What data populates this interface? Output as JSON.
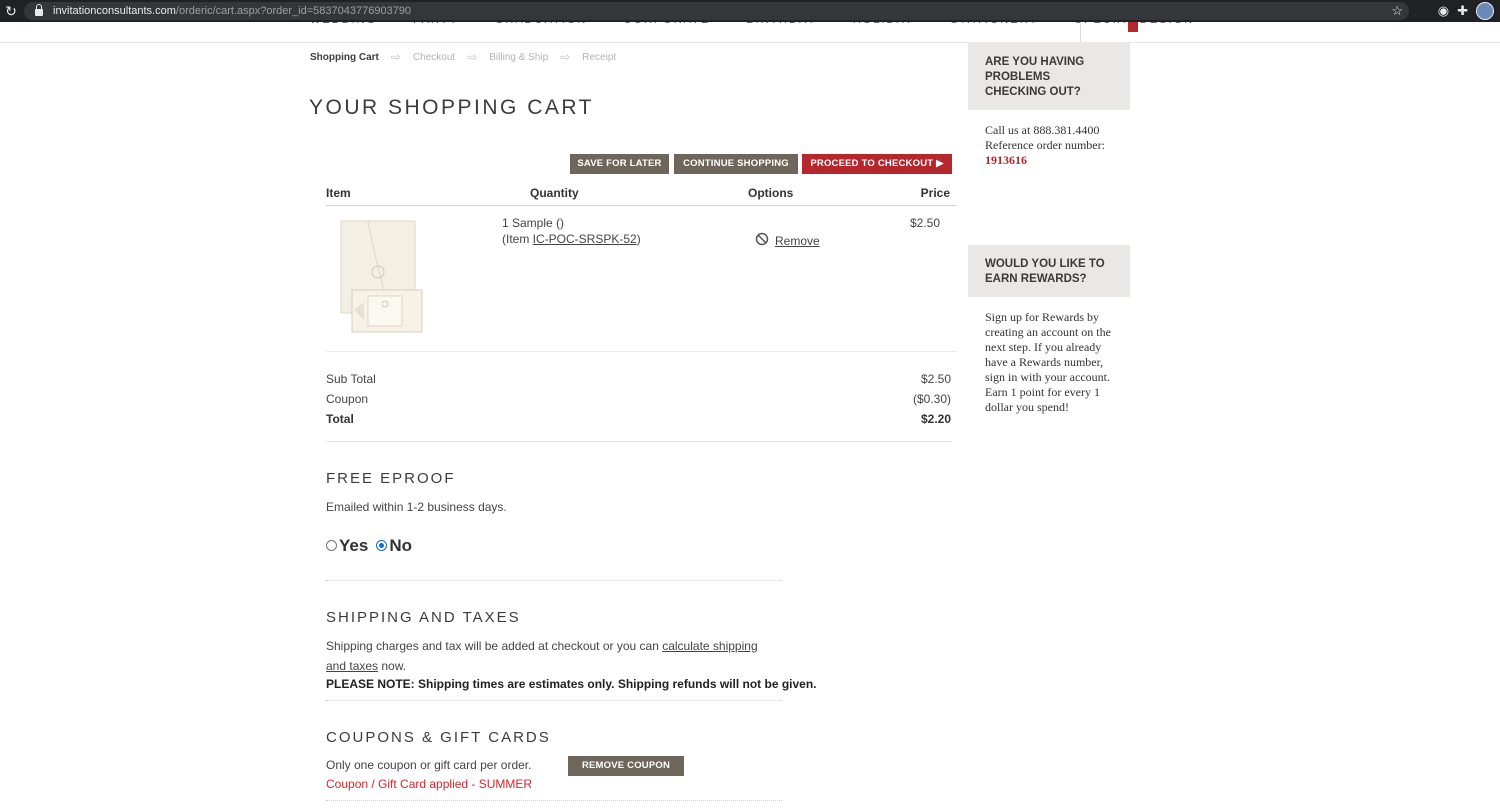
{
  "browser": {
    "url_host": "invitationconsultants.com",
    "url_path": "/orderic/cart.aspx?order_id=5837043776903790"
  },
  "nav": {
    "items": [
      "WEDDING",
      "PARTY",
      "GRADUATION",
      "CORPORATE",
      "BIRTHDAY",
      "HOLIDAY",
      "STATIONERY",
      "SPECIAL DESIGN"
    ]
  },
  "steps": [
    "Shopping Cart",
    "Checkout",
    "Billing & Ship",
    "Receipt"
  ],
  "page_title": "YOUR SHOPPING CART",
  "actions": {
    "save_later": "SAVE FOR LATER",
    "continue": "CONTINUE SHOPPING",
    "checkout": "PROCEED TO CHECKOUT"
  },
  "table": {
    "headers": {
      "item": "Item",
      "quantity": "Quantity",
      "options": "Options",
      "price": "Price"
    },
    "row": {
      "qty_line": "1 Sample ()",
      "item_prefix": "(Item ",
      "item_code": "IC-POC-SRSPK-52",
      "item_suffix": ")",
      "remove": "Remove",
      "price": "$2.50"
    }
  },
  "totals": {
    "subtotal_label": "Sub Total",
    "subtotal": "$2.50",
    "coupon_label": "Coupon",
    "coupon": "($0.30)",
    "total_label": "Total",
    "total": "$2.20"
  },
  "eproof": {
    "title": "FREE EPROOF",
    "desc": "Emailed within 1-2 business days.",
    "yes": "Yes",
    "no": "No",
    "selected": "No"
  },
  "shipping": {
    "title": "SHIPPING AND TAXES",
    "text_before": "Shipping charges and tax will be added at checkout or you can ",
    "link": "calculate shipping and taxes",
    "text_after": " now.",
    "note": "PLEASE NOTE: Shipping times are estimates only. Shipping refunds will not be given."
  },
  "coupons": {
    "title": "COUPONS & GIFT CARDS",
    "desc": "Only one coupon or gift card per order.",
    "remove_button": "REMOVE COUPON",
    "applied": "Coupon / Gift Card applied - SUMMER"
  },
  "sidebar": {
    "help_title": "ARE YOU HAVING PROBLEMS CHECKING OUT?",
    "help_text": "Call us at 888.381.4400 Reference order number: ",
    "ref_number": "1913616",
    "rewards_title": "WOULD YOU LIKE TO EARN REWARDS?",
    "rewards_text": "Sign up for Rewards by creating an account on the next step. If you already have a Rewards number, sign in with your account. Earn 1 point for every 1 dollar you spend!"
  },
  "colors": {
    "accent_red": "#b4272d",
    "button_taupe": "#6e665b",
    "coupon_red": "#d5262d"
  }
}
